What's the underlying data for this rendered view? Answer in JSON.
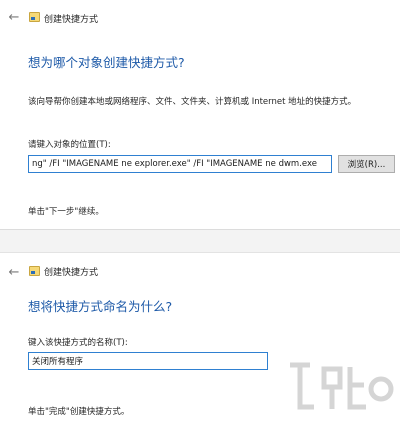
{
  "wizard_title": "创建快捷方式",
  "step1": {
    "heading": "想为哪个对象创建快捷方式?",
    "description": "该向导帮你创建本地或网络程序、文件、文件夹、计算机或 Internet 地址的快捷方式。",
    "location_label": "请键入对象的位置(T):",
    "location_value": "ng\" /FI \"IMAGENAME ne explorer.exe\" /FI \"IMAGENAME ne dwm.exe",
    "browse_label": "浏览(R)...",
    "hint": "单击\"下一步\"继续。"
  },
  "step2": {
    "heading": "想将快捷方式命名为什么?",
    "name_label": "键入该快捷方式的名称(T):",
    "name_value": "关闭所有程序",
    "hint": "单击\"完成\"创建快捷方式。"
  },
  "icons": {
    "back": "back-arrow-icon",
    "app": "shortcut-wizard-icon"
  },
  "colors": {
    "heading": "#1e5aa8",
    "input_focus_border": "#2f80d1",
    "button_bg": "#e1e1e1"
  }
}
